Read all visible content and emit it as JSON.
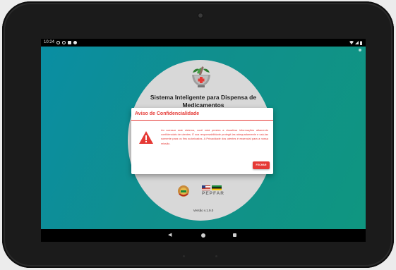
{
  "status_bar": {
    "time": "10:24",
    "left_icons": [
      "circle-icon",
      "circle-icon",
      "image-icon",
      "settings-icon"
    ],
    "right_icons": [
      "wifi-icon",
      "signal-icon",
      "battery-icon"
    ]
  },
  "app": {
    "title": "Sistema Inteligente para Dispensa de Medicamentos",
    "version": "Versão v.1.9.0",
    "partner_logo": "PEPFAR",
    "background_colors": [
      "#0a8ea3",
      "#0f9680"
    ]
  },
  "dialog": {
    "title": "Aviso de Confidencialidade",
    "message": "Ao acessar este sistema, você está prestes a visualizar informações altamente confidenciais de utentes. É sua responsabilidade protegê-las adequadamente e usá-las somente para os fins autorizados. A Privacidade dos utentes é essencial para a nossa missão.",
    "button_label": "FECHAR",
    "accent_color": "#e53935"
  },
  "navbar": {
    "back": "◀",
    "home": "home-icon",
    "recent": "recent-apps-icon"
  }
}
